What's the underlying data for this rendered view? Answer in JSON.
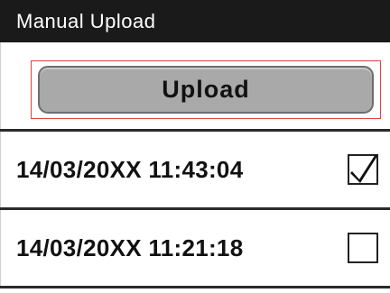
{
  "header": {
    "title": "Manual Upload"
  },
  "upload": {
    "button_label": "Upload"
  },
  "records": [
    {
      "timestamp": "14/03/20XX 11:43:04",
      "checked": true
    },
    {
      "timestamp": "14/03/20XX 11:21:18",
      "checked": false
    }
  ],
  "colors": {
    "title_background": "#1a1a1a",
    "title_text": "#ffffff",
    "button_fill": "#a9a9a9",
    "focus_outline": "#e34141",
    "divider": "#2a2a2a"
  }
}
